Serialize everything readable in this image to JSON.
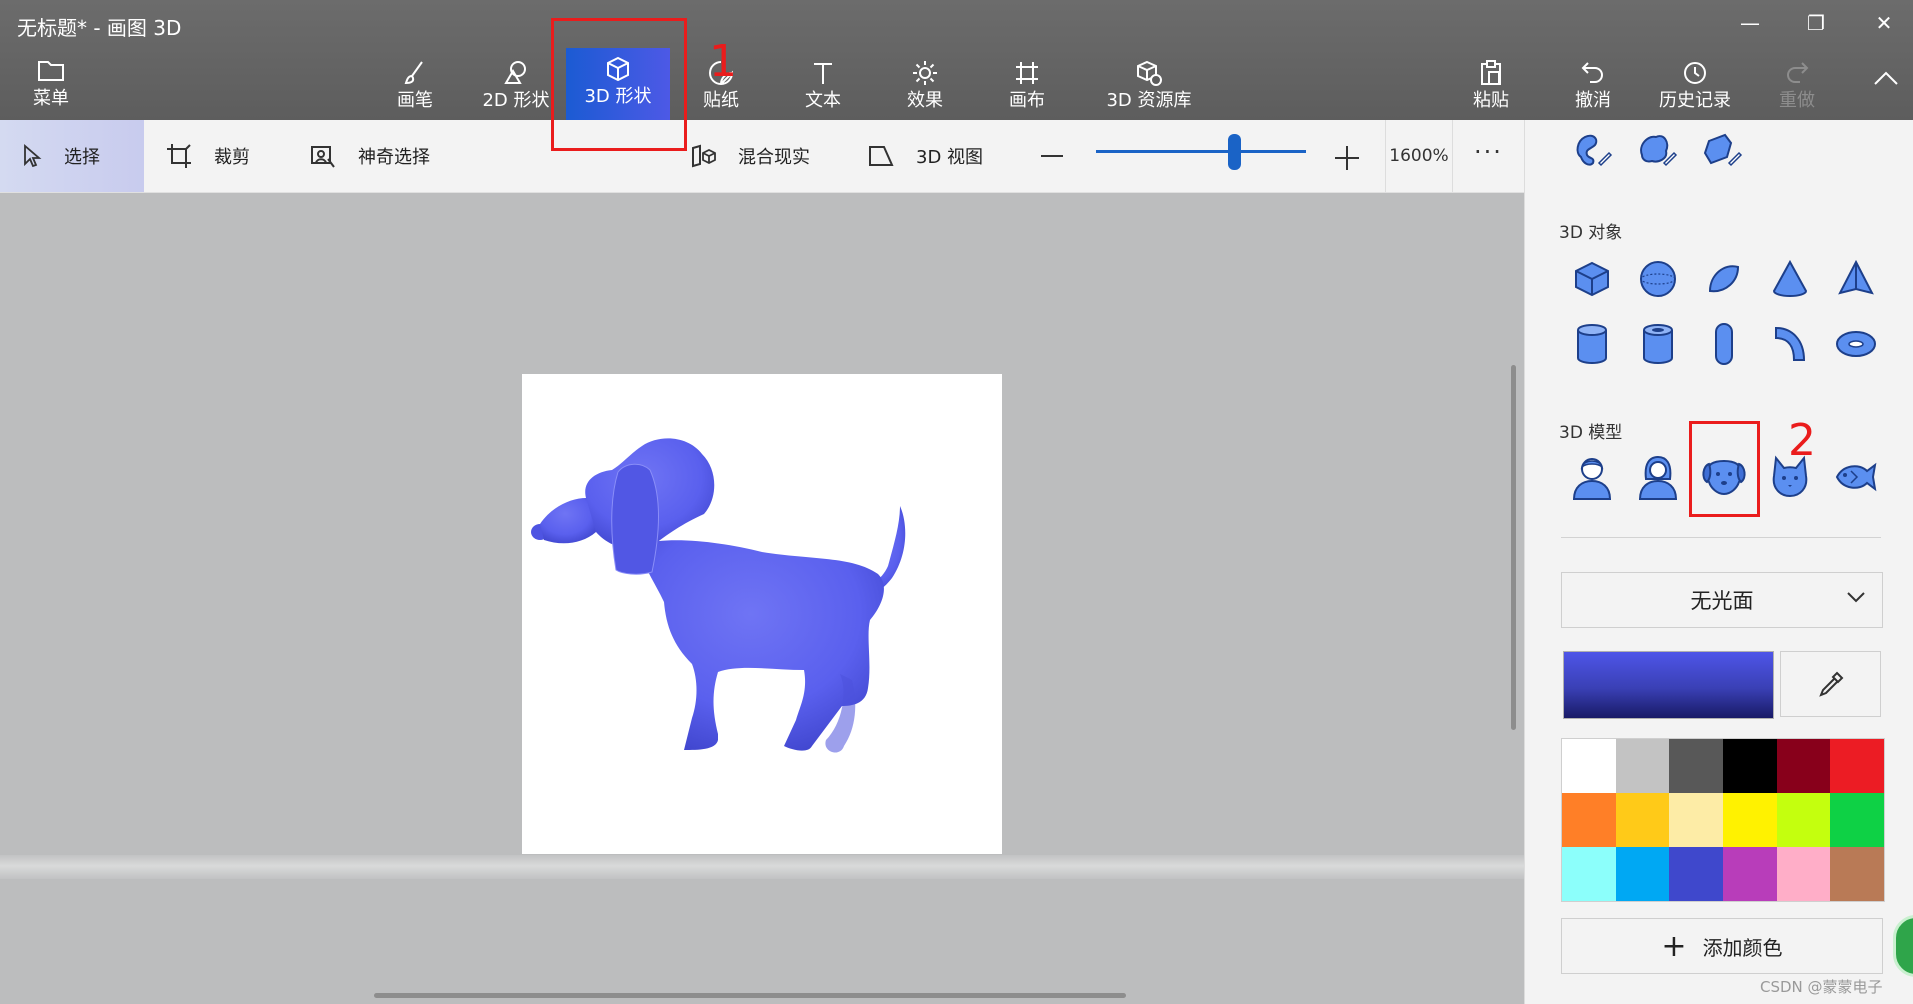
{
  "window": {
    "title": "无标题* - 画图 3D",
    "controls": {
      "minimize": "—",
      "maximize": "❐",
      "close": "✕"
    }
  },
  "toolbar": {
    "menu": "菜单",
    "brushes": "画笔",
    "shapes_2d": "2D 形状",
    "shapes_3d": "3D 形状",
    "stickers": "贴纸",
    "text": "文本",
    "effects": "效果",
    "canvas": "画布",
    "library_3d": "3D 资源库",
    "paste": "粘贴",
    "undo": "撤消",
    "history": "历史记录",
    "redo": "重做",
    "active_tool": "3D 形状"
  },
  "subbar": {
    "select": "选择",
    "crop": "裁剪",
    "magic_select": "神奇选择",
    "mixed_reality": "混合现实",
    "view_3d": "3D 视图",
    "zoom_percent": "1600",
    "zoom_unit": "%",
    "zoom_level": 0.66,
    "more": "···"
  },
  "panel": {
    "objects_heading": "3D 对象",
    "models_heading": "3D 模型",
    "doodles": [
      "3d-doodle-sharp-icon",
      "3d-doodle-soft-icon",
      "3d-doodle-tube-icon"
    ],
    "objects": [
      "cube-icon",
      "sphere-icon",
      "hemisphere-icon",
      "cone-icon",
      "pyramid-icon",
      "cylinder-icon",
      "tube-icon",
      "capsule-icon",
      "bent-tube-icon",
      "torus-icon"
    ],
    "models": [
      "man-icon",
      "woman-icon",
      "dog-icon",
      "cat-icon",
      "fish-icon"
    ],
    "selected_model": "dog-icon",
    "finish": "无光面",
    "add_color": "添加颜色",
    "current_color": "#3f46d6",
    "palette": [
      "#ffffff",
      "#c3c3c3",
      "#585858",
      "#000000",
      "#88001b",
      "#ec1c24",
      "#ff7f27",
      "#ffca18",
      "#fdeca6",
      "#fff200",
      "#c4ff0e",
      "#0ed145",
      "#8cfffb",
      "#00a8f3",
      "#3f48cc",
      "#b83dba",
      "#ffaec8",
      "#b97a56"
    ]
  },
  "annotations": {
    "step1": "1",
    "step2": "2"
  },
  "watermark": "CSDN @蒙蒙电子"
}
